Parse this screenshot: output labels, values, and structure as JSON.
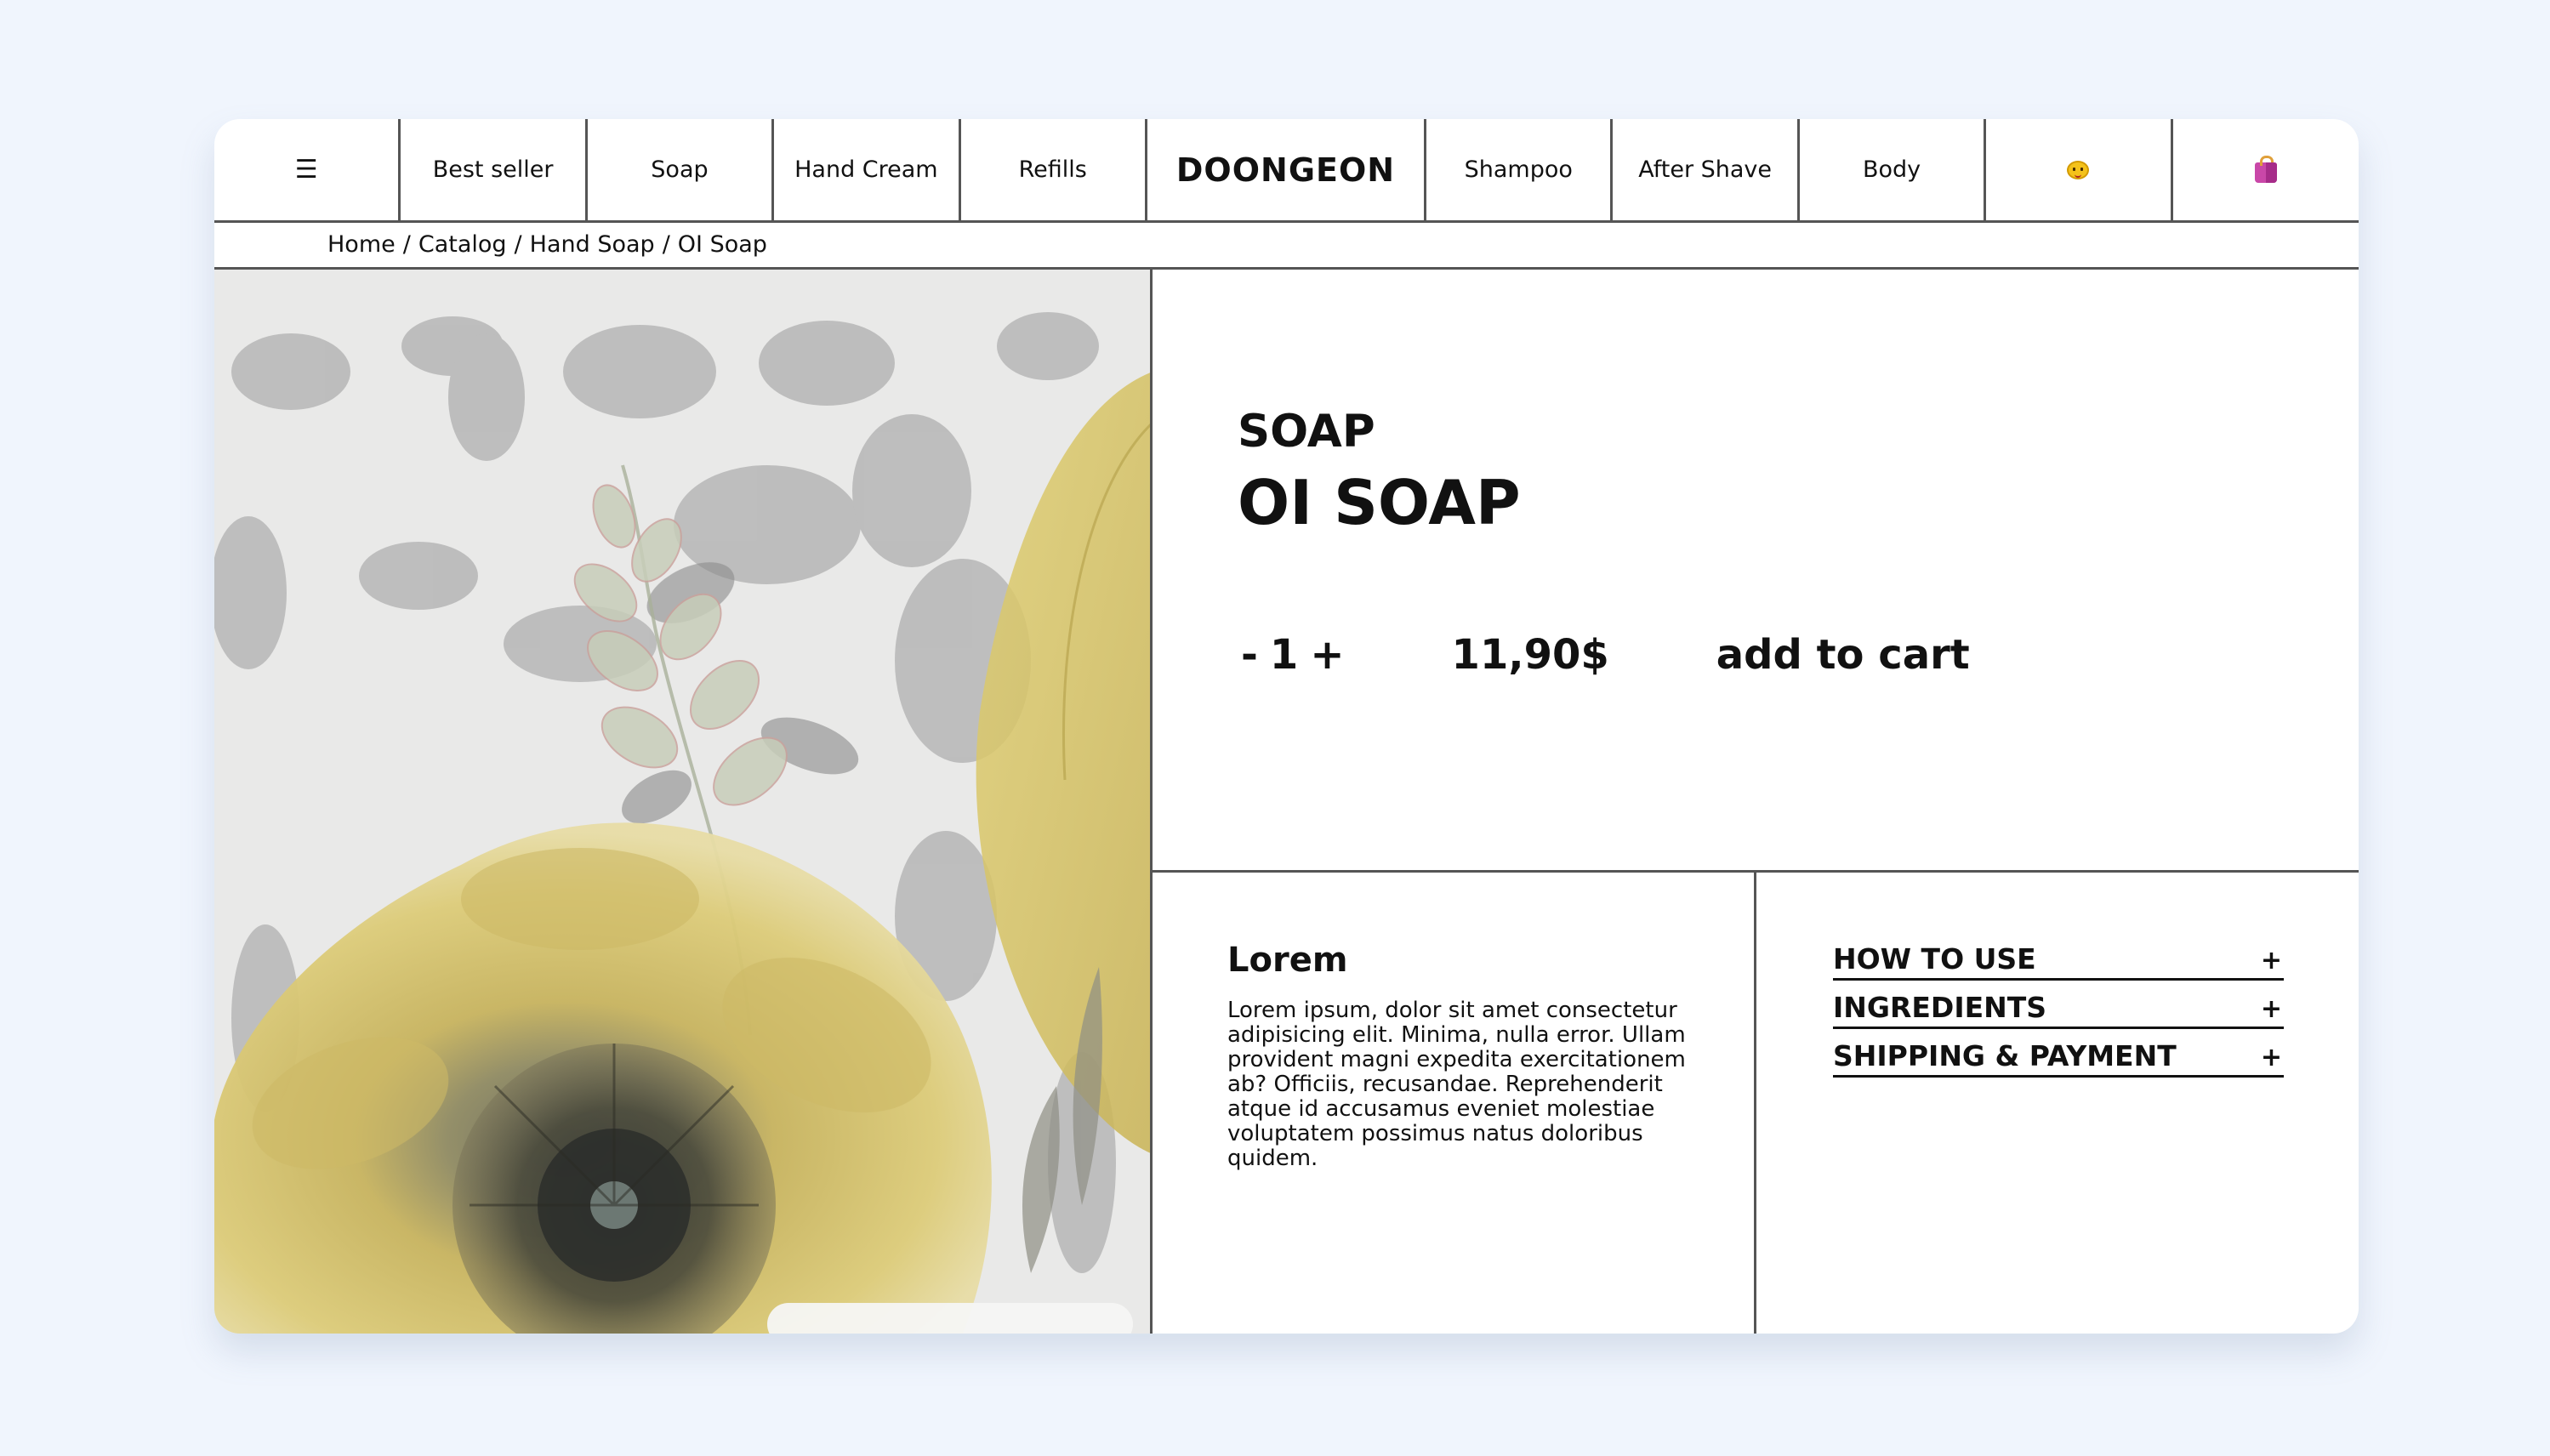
{
  "nav": {
    "menu_glyph": "☰",
    "links": [
      "Best seller",
      "Soap",
      "Hand Cream",
      "Refills"
    ],
    "brand": "DOONGEON",
    "links_right": [
      "Shampoo",
      "After Shave",
      "Body"
    ],
    "account_icon": "smiling-face-icon",
    "cart_icon": "shopping-bag-icon"
  },
  "breadcrumb": {
    "items": [
      "Home",
      "Catalog",
      "Hand Soap",
      "OI Soap"
    ],
    "separator": "/"
  },
  "product": {
    "category": "SOAP",
    "name": "OI SOAP",
    "qty_minus": "-",
    "quantity": "1",
    "qty_plus": "+",
    "price": "11,90$",
    "add_to_cart": "add to cart"
  },
  "description": {
    "title": "Lorem",
    "body": "Lorem ipsum, dolor sit amet consectetur adipisicing elit. Minima, nulla error. Ullam provident magni expedita exercitationem ab? Officiis, recusandae. Reprehenderit atque id accusamus eveniet molestiae voluptatem possimus natus doloribus quidem."
  },
  "accordion": {
    "items": [
      {
        "label": "HOW TO USE",
        "icon": "+"
      },
      {
        "label": "INGREDIENTS",
        "icon": "+"
      },
      {
        "label": "SHIPPING & PAYMENT",
        "icon": "+"
      }
    ]
  },
  "colors": {
    "page_background": "#f0f5fd",
    "card_background": "#ffffff",
    "border": "#555555",
    "text": "#111111",
    "flower_yellow": "#d6c261",
    "leaf_gray": "#9d9d9d"
  }
}
